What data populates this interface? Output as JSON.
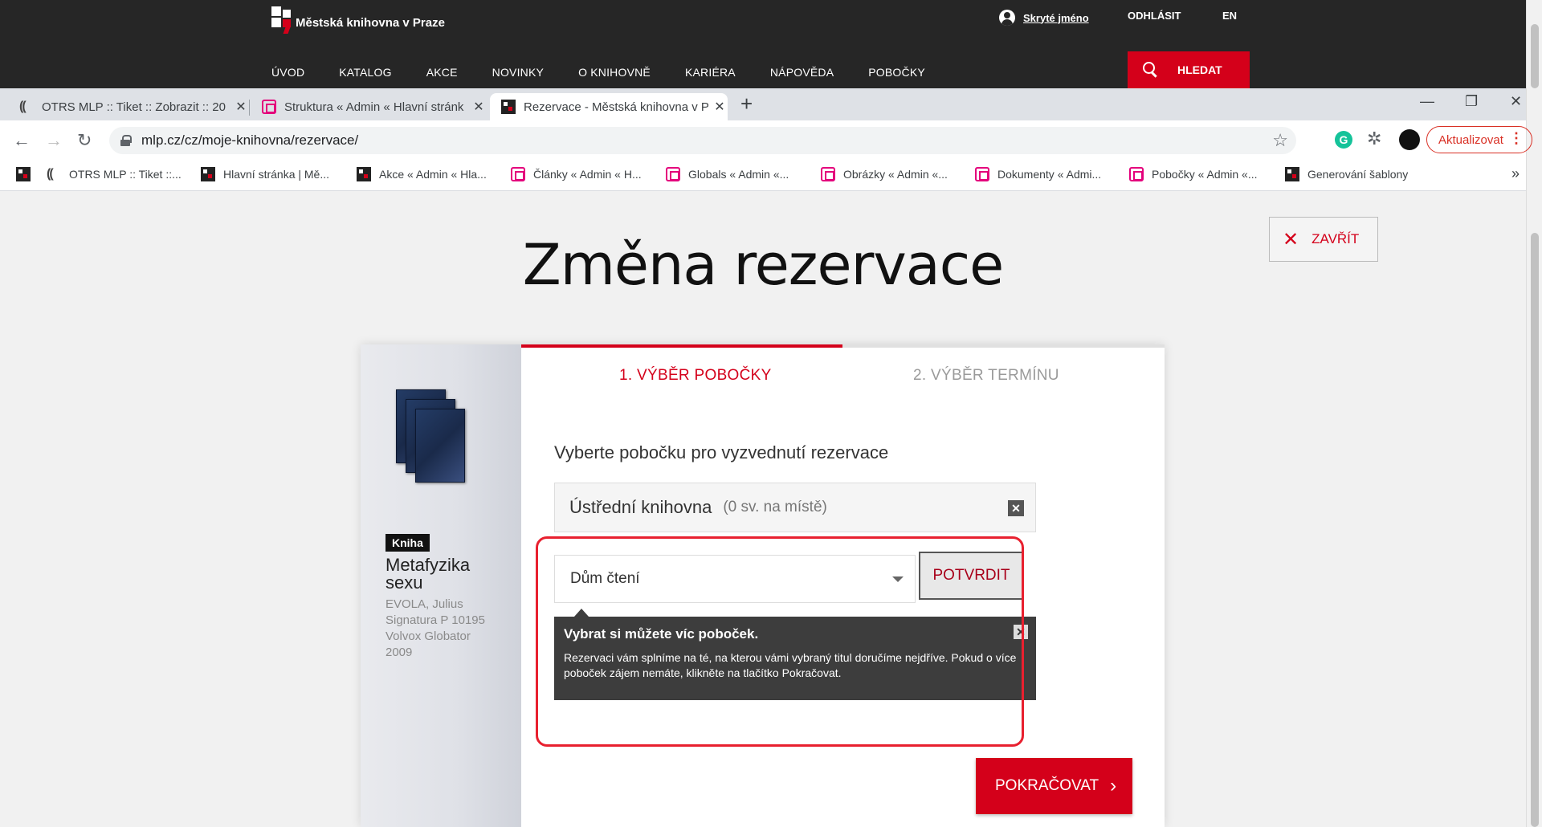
{
  "site": {
    "logo_text": "Městská knihovna v Praze",
    "user_name": "Skryté jméno",
    "logout": "ODHLÁSIT",
    "lang": "EN",
    "nav": [
      "ÚVOD",
      "KATALOG",
      "AKCE",
      "NOVINKY",
      "O KNIHOVNĚ",
      "KARIÉRA",
      "NÁPOVĚDA",
      "POBOČKY"
    ],
    "search_label": "HLEDAT"
  },
  "browser": {
    "tabs": [
      {
        "title": "OTRS MLP :: Tiket :: Zobrazit :: 20",
        "icon": "otrs-icon"
      },
      {
        "title": "Struktura « Admin « Hlavní stránk",
        "icon": "admin-icon"
      },
      {
        "title": "Rezervace - Městská knihovna v P",
        "icon": "mlp-icon"
      }
    ],
    "new_tab": "+",
    "url": "mlp.cz/cz/moje-knihovna/rezervace/",
    "update_label": "Aktualizovat",
    "bookmarks": [
      {
        "label": "",
        "icon": "mlp-icon"
      },
      {
        "label": "OTRS MLP :: Tiket ::...",
        "icon": "otrs-icon"
      },
      {
        "label": "Hlavní stránka | Mě...",
        "icon": "mlp-icon"
      },
      {
        "label": "Akce « Admin « Hla...",
        "icon": "mlp-icon"
      },
      {
        "label": "Články « Admin « H...",
        "icon": "admin-icon"
      },
      {
        "label": "Globals « Admin «...",
        "icon": "admin-icon"
      },
      {
        "label": "Obrázky « Admin «...",
        "icon": "admin-icon"
      },
      {
        "label": "Dokumenty « Admi...",
        "icon": "admin-icon"
      },
      {
        "label": "Pobočky « Admin «...",
        "icon": "admin-icon"
      },
      {
        "label": "Generování šablony",
        "icon": "template-icon"
      }
    ],
    "bookmarks_more": "»"
  },
  "page": {
    "title": "Změna rezervace",
    "close_label": "ZAVŘÍT",
    "book": {
      "type": "Kniha",
      "title": "Metafyzika sexu",
      "author": "EVOLA, Julius",
      "signature": "Signatura P 10195",
      "publisher": "Volvox Globator",
      "year": "2009"
    },
    "steps": [
      "1. VÝBĚR POBOČKY",
      "2. VÝBĚR TERMÍNU"
    ],
    "select_label": "Vyberte pobočku pro vyzvednutí rezervace",
    "selected_branch": {
      "name": "Ústřední knihovna",
      "count": "(0 sv. na místě)"
    },
    "branch_dropdown": "Dům čtení",
    "confirm_label": "POTVRDIT",
    "tooltip": {
      "title": "Vybrat si můžete víc poboček.",
      "text": "Rezervaci vám splníme na té, na kterou vámi vybraný titul doručíme nejdříve. Pokud o více poboček zájem nemáte, klikněte na tlačítko Pokračovat."
    },
    "continue_label": "POKRAČOVAT"
  },
  "colors": {
    "brand_red": "#d4001a",
    "header_bg": "#262626",
    "highlight": "#e8202f"
  }
}
